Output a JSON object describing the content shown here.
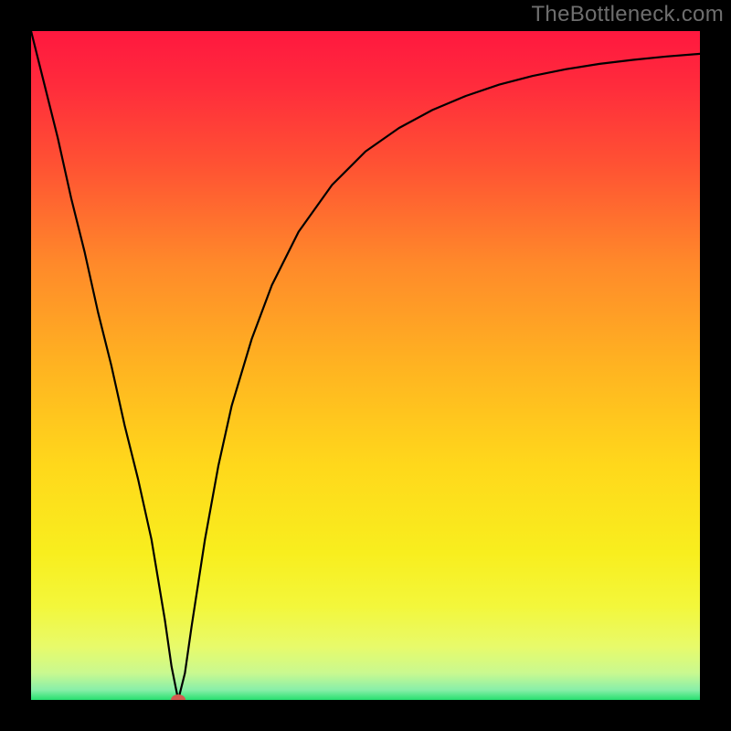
{
  "watermark": "TheBottleneck.com",
  "chart_data": {
    "type": "line",
    "title": "",
    "xlabel": "",
    "ylabel": "",
    "xlim": [
      0,
      100
    ],
    "ylim": [
      0,
      100
    ],
    "grid": false,
    "legend": false,
    "background_gradient": {
      "stops": [
        {
          "t": 0.0,
          "color": "#ff183f"
        },
        {
          "t": 0.08,
          "color": "#ff2b3c"
        },
        {
          "t": 0.2,
          "color": "#ff5233"
        },
        {
          "t": 0.35,
          "color": "#ff8a2a"
        },
        {
          "t": 0.5,
          "color": "#ffb321"
        },
        {
          "t": 0.65,
          "color": "#ffd81b"
        },
        {
          "t": 0.78,
          "color": "#f8ee1e"
        },
        {
          "t": 0.86,
          "color": "#f3f73b"
        },
        {
          "t": 0.92,
          "color": "#e8fa6a"
        },
        {
          "t": 0.96,
          "color": "#c9f990"
        },
        {
          "t": 0.985,
          "color": "#88efa9"
        },
        {
          "t": 1.0,
          "color": "#27e06f"
        }
      ]
    },
    "series": [
      {
        "name": "bottleneck-curve",
        "x": [
          0,
          2,
          4,
          6,
          8,
          10,
          12,
          14,
          16,
          18,
          20,
          21,
          22,
          23,
          24,
          26,
          28,
          30,
          33,
          36,
          40,
          45,
          50,
          55,
          60,
          65,
          70,
          75,
          80,
          85,
          90,
          95,
          100
        ],
        "y": [
          100,
          92,
          84,
          75,
          67,
          58,
          50,
          41,
          33,
          24,
          12,
          5,
          0,
          4,
          11,
          24,
          35,
          44,
          54,
          62,
          70,
          77,
          82,
          85.5,
          88.2,
          90.3,
          92,
          93.3,
          94.3,
          95.1,
          95.7,
          96.2,
          96.6
        ]
      }
    ],
    "marker": {
      "x": 22,
      "y": 0,
      "color": "#d45a4f"
    }
  }
}
